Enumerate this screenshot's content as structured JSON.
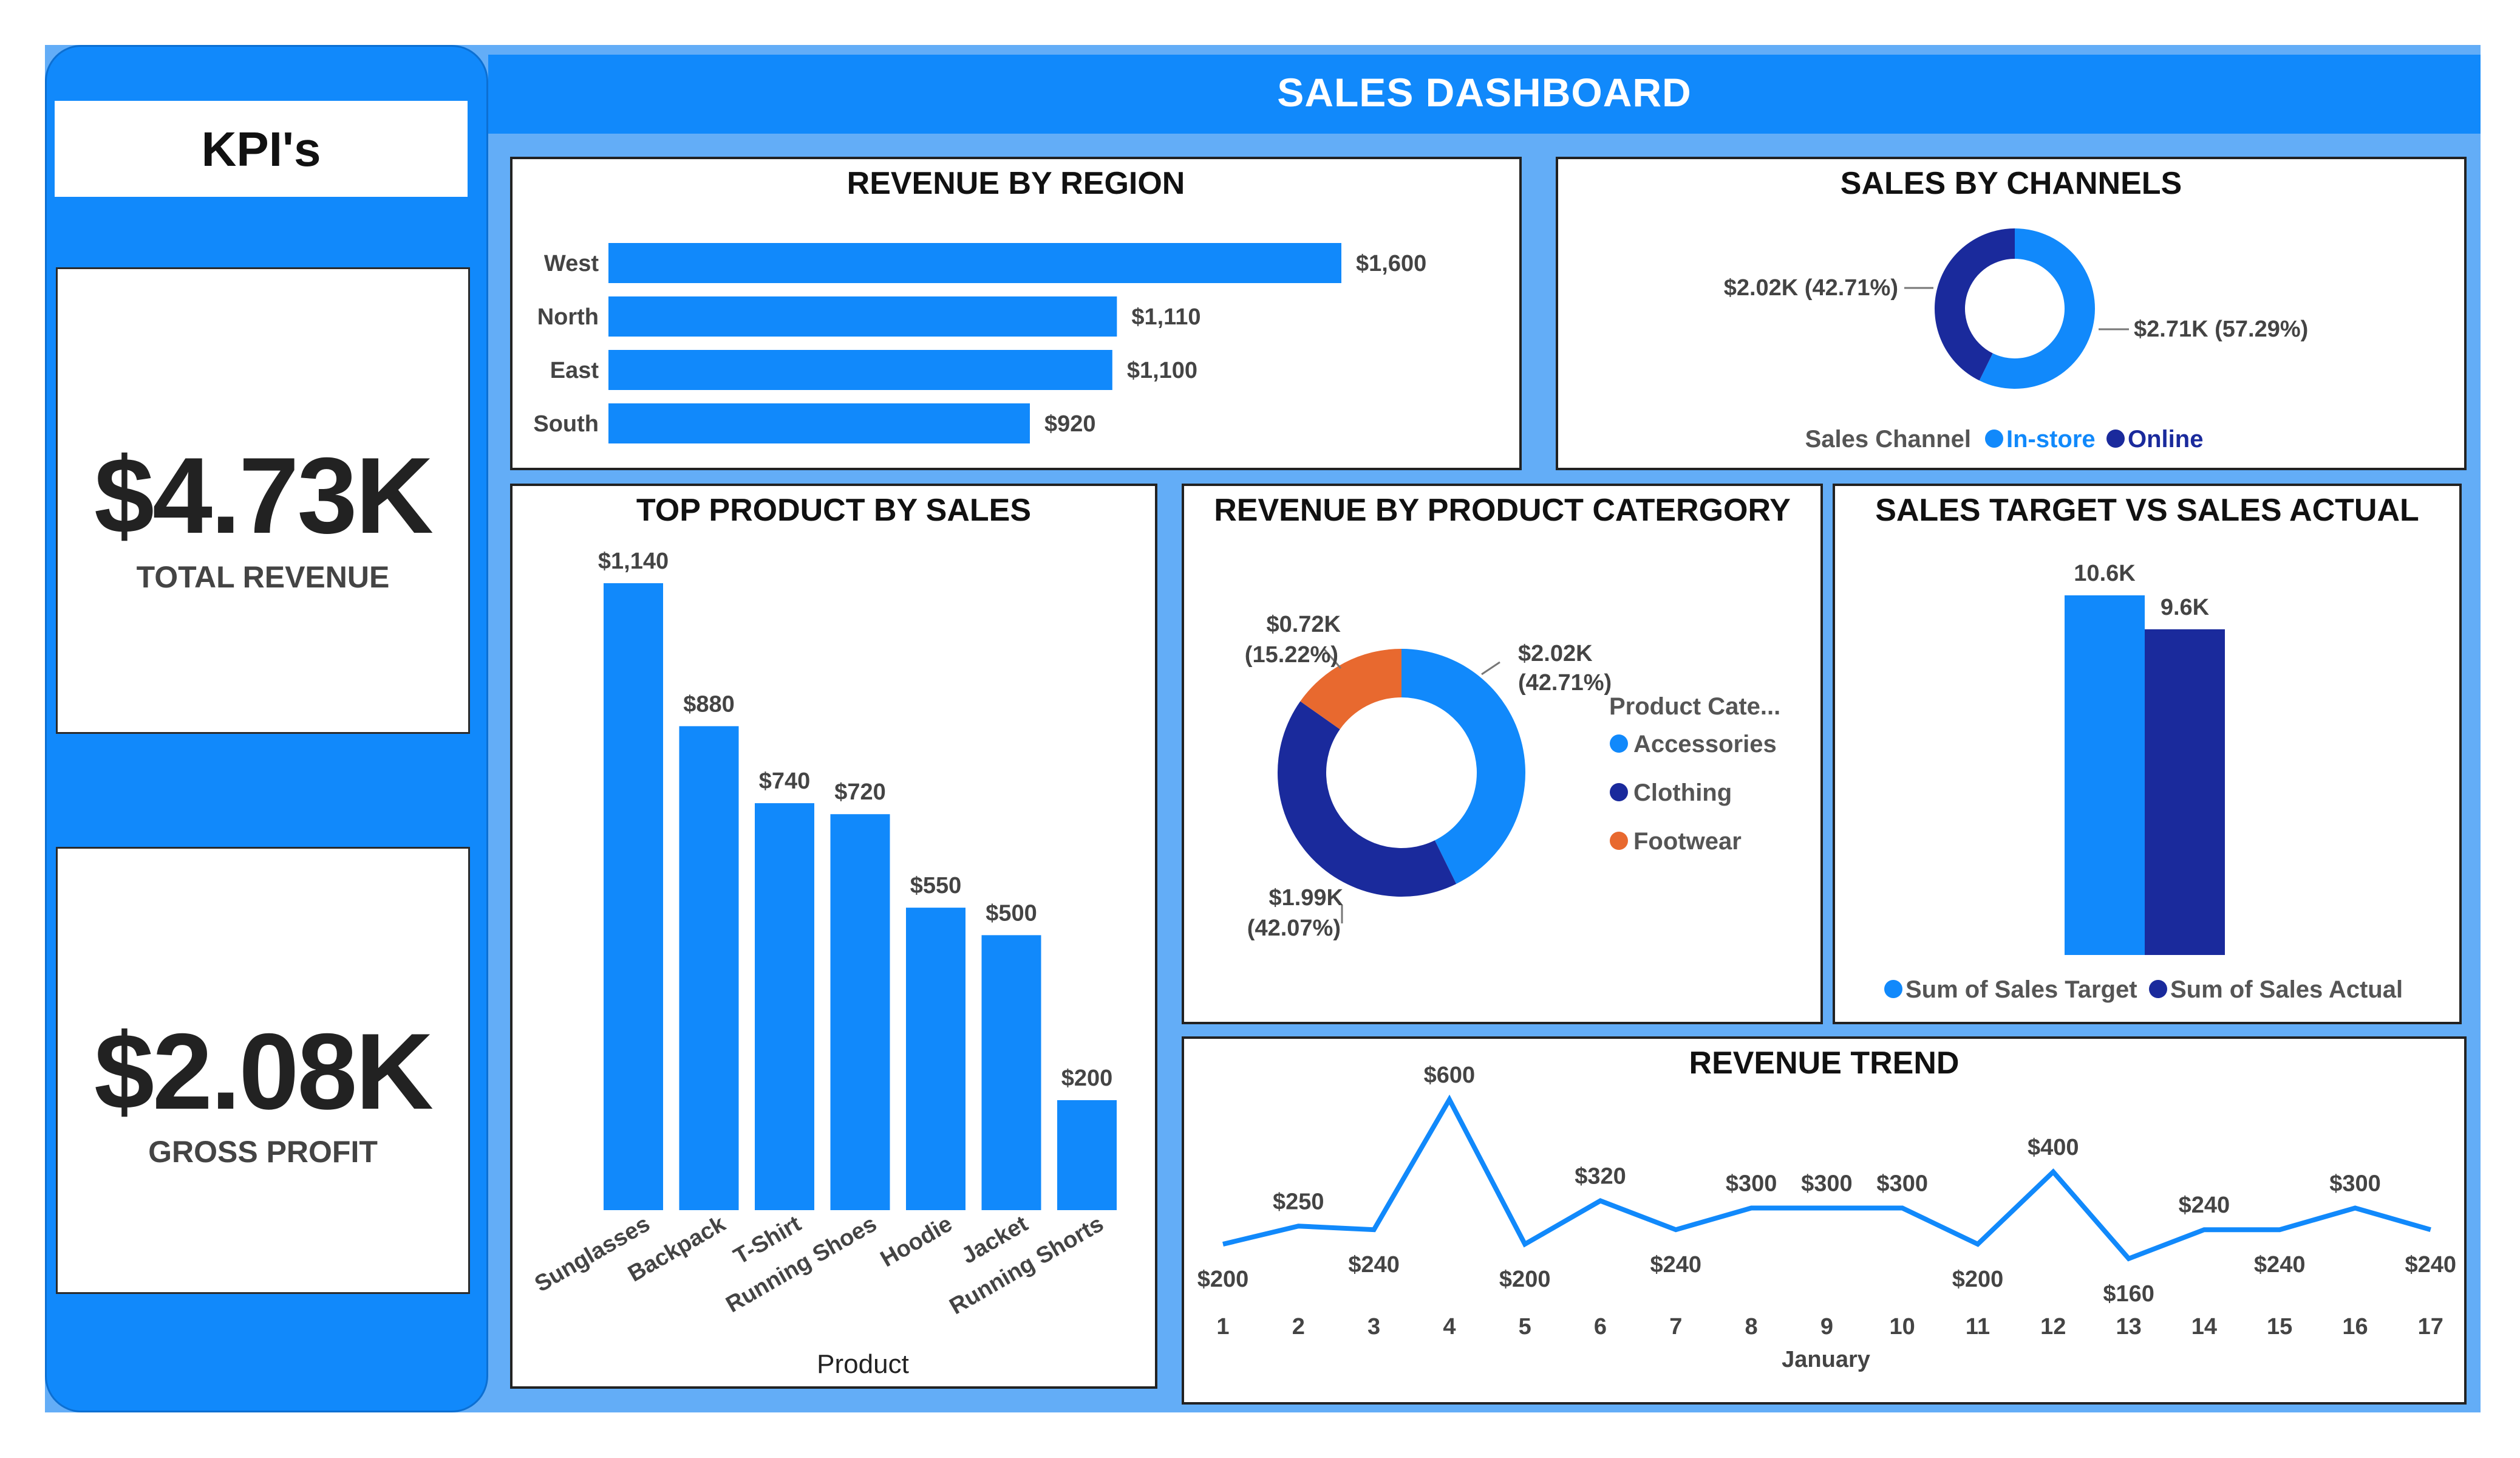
{
  "dashboard_title": "SALES DASHBOARD",
  "colors": {
    "primary": "#1189fb",
    "dark": "#1a2a9c",
    "orange": "#e8692f",
    "panel_bg": "#63adf7"
  },
  "kpi": {
    "header": "KPI's",
    "total_revenue": {
      "value": "$4.73K",
      "label": "TOTAL REVENUE"
    },
    "gross_profit": {
      "value": "$2.08K",
      "label": "GROSS PROFIT"
    }
  },
  "chart_data": [
    {
      "id": "revenue_by_region",
      "type": "bar",
      "orientation": "horizontal",
      "title": "REVENUE BY REGION",
      "categories": [
        "West",
        "North",
        "East",
        "South"
      ],
      "values": [
        1600,
        1110,
        1100,
        920
      ],
      "value_labels": [
        "$1,600",
        "$1,110",
        "$1,100",
        "$920"
      ]
    },
    {
      "id": "sales_by_channels",
      "type": "pie",
      "title": "SALES BY CHANNELS",
      "legend_title": "Sales Channel",
      "slices": [
        {
          "name": "In-store",
          "value": 57.29,
          "label": "$2.71K (57.29%)",
          "color": "#1189fb"
        },
        {
          "name": "Online",
          "value": 42.71,
          "label": "$2.02K (42.71%)",
          "color": "#1a2a9c"
        }
      ]
    },
    {
      "id": "top_product_by_sales",
      "type": "bar",
      "title": "TOP PRODUCT BY SALES",
      "xlabel": "Product",
      "categories": [
        "Sunglasses",
        "Backpack",
        "T-Shirt",
        "Running Shoes",
        "Hoodie",
        "Jacket",
        "Running Shorts"
      ],
      "values": [
        1140,
        880,
        740,
        720,
        550,
        500,
        200
      ],
      "value_labels": [
        "$1,140",
        "$880",
        "$740",
        "$720",
        "$550",
        "$500",
        "$200"
      ]
    },
    {
      "id": "revenue_by_product_category",
      "type": "pie",
      "title": "REVENUE BY PRODUCT CATERGORY",
      "legend_title": "Product Cate...",
      "slices": [
        {
          "name": "Accessories",
          "value": 42.71,
          "label_line1": "$2.02K",
          "label_line2": "(42.71%)",
          "color": "#1189fb"
        },
        {
          "name": "Clothing",
          "value": 42.07,
          "label_line1": "$1.99K",
          "label_line2": "(42.07%)",
          "color": "#1a2a9c"
        },
        {
          "name": "Footwear",
          "value": 15.22,
          "label_line1": "$0.72K",
          "label_line2": "(15.22%)",
          "color": "#e8692f"
        }
      ]
    },
    {
      "id": "sales_target_vs_actual",
      "type": "bar",
      "title": "SALES TARGET VS SALES ACTUAL",
      "series": [
        {
          "name": "Sum of Sales Target",
          "values": [
            10600
          ],
          "label": "10.6K",
          "color": "#1189fb"
        },
        {
          "name": "Sum of Sales Actual",
          "values": [
            9600
          ],
          "label": "9.6K",
          "color": "#1a2a9c"
        }
      ],
      "ylim": [
        0,
        12000
      ]
    },
    {
      "id": "revenue_trend",
      "type": "line",
      "title": "REVENUE TREND",
      "xlabel": "January",
      "x": [
        1,
        2,
        3,
        4,
        5,
        6,
        7,
        8,
        9,
        10,
        11,
        12,
        13,
        14,
        15,
        16,
        17
      ],
      "values": [
        200,
        250,
        240,
        600,
        200,
        320,
        240,
        300,
        300,
        300,
        200,
        400,
        160,
        240,
        240,
        300,
        240
      ],
      "value_labels": [
        "$200",
        "$250",
        "$240",
        "$600",
        "$200",
        "$320",
        "$240",
        "$300",
        "$300",
        "$300",
        "$200",
        "$400",
        "$160",
        "$240",
        "$240",
        "$300",
        "$240"
      ],
      "ylim": [
        100,
        650
      ]
    }
  ]
}
